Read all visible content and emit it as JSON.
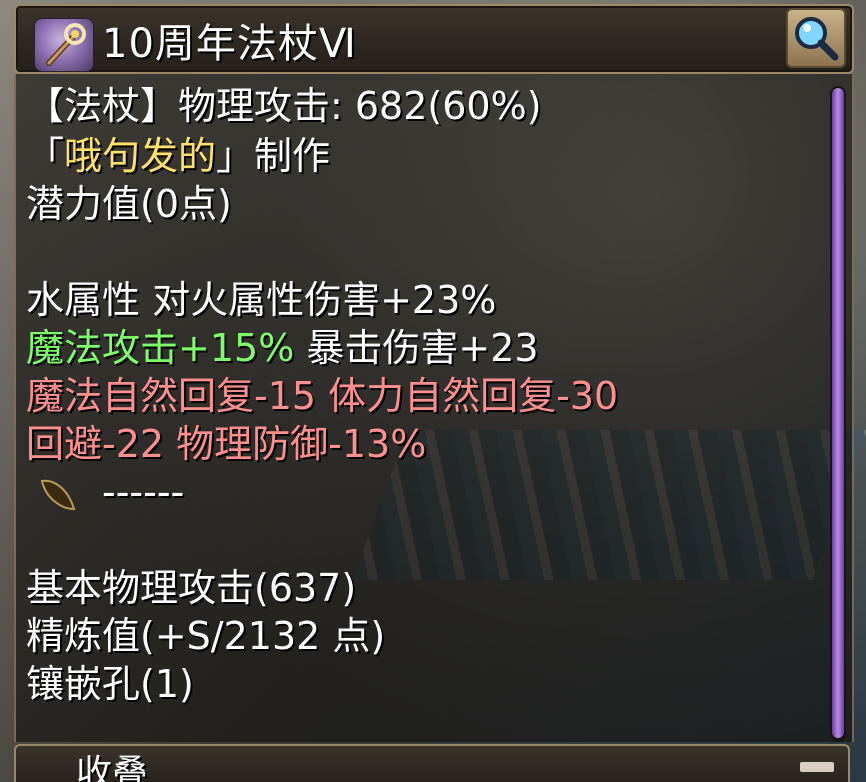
{
  "title_bar": {
    "title": "10周年法杖Ⅵ"
  },
  "tooltip": {
    "lines": [
      {
        "text": "【法杖】物理攻击: 682(60%)"
      },
      {
        "prefix": "「",
        "maker": "哦句发的",
        "suffix": "」制作"
      },
      {
        "text": "潜力值(0点)"
      },
      {
        "text": ""
      },
      {
        "text": "水属性 对火属性伤害+23%"
      },
      {
        "green": "魔法攻击+15%",
        "rest": " 暴击伤害+23"
      },
      {
        "text": "魔法自然回复-15 体力自然回复-30"
      },
      {
        "text": "回避-22 物理防御-13%"
      },
      {
        "slot_text": "------"
      },
      {
        "text": ""
      },
      {
        "text": "基本物理攻击(637)"
      },
      {
        "text": "精炼值(+S/2132 点)"
      },
      {
        "text": "镶嵌孔(1)"
      }
    ]
  },
  "collapse_bar": {
    "label": "收叠"
  },
  "colors": {
    "text_default": "#ffffff",
    "maker_name": "#ffe16b",
    "bonus_green": "#7dff6a",
    "penalty_red": "#ff8f8f",
    "scrollbar": "#b78be6"
  },
  "icons": {
    "item": "wand-icon",
    "search": "magnifier-icon",
    "card_slot": "leaf-slot-icon"
  }
}
